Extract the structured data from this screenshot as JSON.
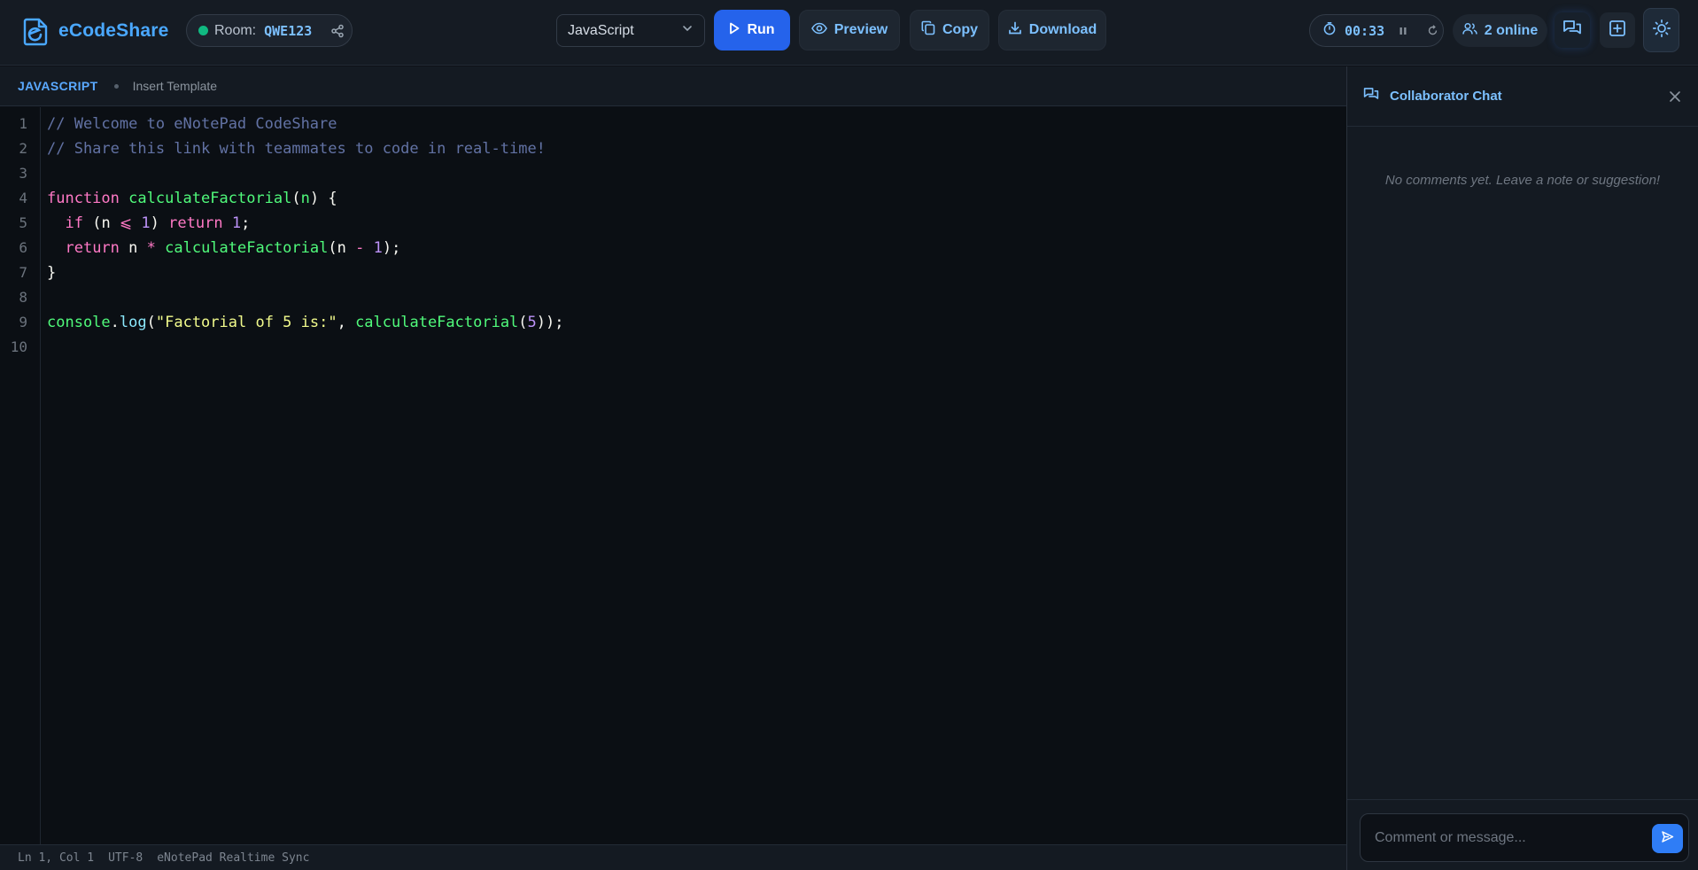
{
  "app": {
    "name": "eCodeShare",
    "colors": {
      "accent": "#4aa8ff",
      "primary": "#2563eb",
      "online": "#10b981",
      "background": "#0d1117"
    }
  },
  "header": {
    "room_label": "Room:",
    "room_code": "QWE123",
    "language": "JavaScript",
    "run_label": "Run",
    "preview_label": "Preview",
    "copy_label": "Copy",
    "download_label": "Download",
    "timer": "00:33",
    "online": "2 online",
    "icons": [
      "share-icon",
      "chevron-down-icon",
      "play-icon",
      "eye-icon",
      "copy-icon",
      "download-icon",
      "timer-icon",
      "pause-icon",
      "reset-icon",
      "users-icon",
      "chat-icon",
      "add-file-icon",
      "sun-icon"
    ]
  },
  "toolbar": {
    "language_tag": "JAVASCRIPT",
    "insert_template": "Insert Template"
  },
  "editor": {
    "line_numbers": [
      "1",
      "2",
      "3",
      "4",
      "5",
      "6",
      "7",
      "8",
      "9",
      "10"
    ],
    "lines": [
      [
        {
          "t": "comment",
          "v": "// Welcome to eNotePad CodeShare"
        }
      ],
      [
        {
          "t": "comment",
          "v": "// Share this link with teammates to code in real-time!"
        }
      ],
      [],
      [
        {
          "t": "kw",
          "v": "function"
        },
        {
          "t": "plain",
          "v": " "
        },
        {
          "t": "fn",
          "v": "calculateFactorial"
        },
        {
          "t": "plain",
          "v": "("
        },
        {
          "t": "param",
          "v": "n"
        },
        {
          "t": "plain",
          "v": ") {"
        }
      ],
      [
        {
          "t": "plain",
          "v": "  "
        },
        {
          "t": "kw",
          "v": "if"
        },
        {
          "t": "plain",
          "v": " (n "
        },
        {
          "t": "kw",
          "v": "⩽"
        },
        {
          "t": "plain",
          "v": " "
        },
        {
          "t": "num",
          "v": "1"
        },
        {
          "t": "plain",
          "v": ") "
        },
        {
          "t": "kw",
          "v": "return"
        },
        {
          "t": "plain",
          "v": " "
        },
        {
          "t": "num",
          "v": "1"
        },
        {
          "t": "plain",
          "v": ";"
        }
      ],
      [
        {
          "t": "plain",
          "v": "  "
        },
        {
          "t": "kw",
          "v": "return"
        },
        {
          "t": "plain",
          "v": " n "
        },
        {
          "t": "kw",
          "v": "*"
        },
        {
          "t": "plain",
          "v": " "
        },
        {
          "t": "fn",
          "v": "calculateFactorial"
        },
        {
          "t": "plain",
          "v": "(n "
        },
        {
          "t": "kw",
          "v": "-"
        },
        {
          "t": "plain",
          "v": " "
        },
        {
          "t": "num",
          "v": "1"
        },
        {
          "t": "plain",
          "v": ");"
        }
      ],
      [
        {
          "t": "plain",
          "v": "}"
        }
      ],
      [],
      [
        {
          "t": "fn",
          "v": "console"
        },
        {
          "t": "plain",
          "v": "."
        },
        {
          "t": "method",
          "v": "log"
        },
        {
          "t": "plain",
          "v": "("
        },
        {
          "t": "str",
          "v": "\"Factorial of 5 is:\""
        },
        {
          "t": "plain",
          "v": ", "
        },
        {
          "t": "fn",
          "v": "calculateFactorial"
        },
        {
          "t": "plain",
          "v": "("
        },
        {
          "t": "num",
          "v": "5"
        },
        {
          "t": "plain",
          "v": "));"
        }
      ],
      []
    ]
  },
  "status": {
    "position": "Ln 1, Col 1",
    "encoding": "UTF-8",
    "sync": "eNotePad Realtime Sync"
  },
  "chat": {
    "title": "Collaborator Chat",
    "empty_message": "No comments yet. Leave a note or suggestion!",
    "input_placeholder": "Comment or message..."
  }
}
